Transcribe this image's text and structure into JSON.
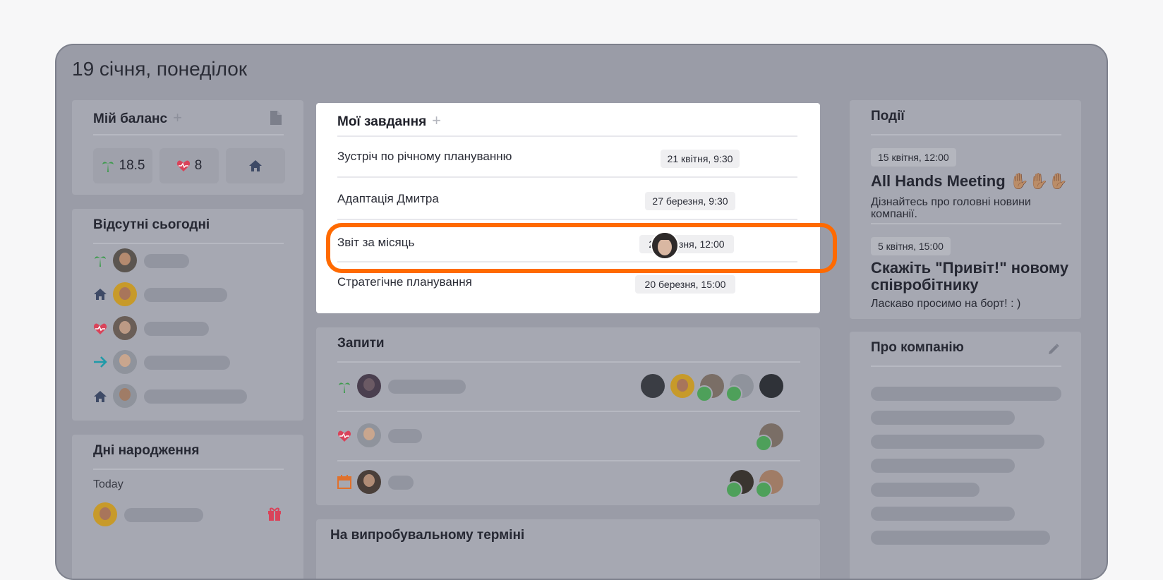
{
  "header": {
    "date": "19 січня, понеділок"
  },
  "balance": {
    "title": "Мій баланс",
    "vacation_days": "18.5",
    "sick_days": "8"
  },
  "absent": {
    "title": "Відсутні сьогодні"
  },
  "birthdays": {
    "title": "Дні народження",
    "today_label": "Today"
  },
  "tasks": {
    "title": "Мої завдання",
    "items": [
      {
        "name": "Зустріч по річному плануванню",
        "date": "21 квітня, 9:30"
      },
      {
        "name": "Адаптація Дмитра",
        "date": "27 березня, 9:30"
      },
      {
        "name": "Звіт за місяць",
        "date": "2 березня, 12:00"
      },
      {
        "name": "Стратегічне планування",
        "date": "20 березня, 15:00"
      }
    ]
  },
  "requests": {
    "title": "Запити"
  },
  "probation": {
    "title": "На випробувальному терміні"
  },
  "events": {
    "title": "Події",
    "items": [
      {
        "date": "15 квітня, 12:00",
        "title": "All Hands Meeting ✋🏽✋🏽✋🏽",
        "desc": "Дізнайтесь про головні новини компанії."
      },
      {
        "date": "5 квітня, 15:00",
        "title": "Скажіть \"Привіт!\" новому співробітнику",
        "desc": "Ласкаво просимо на борт! : )"
      }
    ]
  },
  "company": {
    "title": "Про компанію"
  },
  "colors": {
    "accent_highlight": "#ff6a00",
    "palm_green": "#3f9b4e",
    "heart_red": "#d9435a",
    "home_navy": "#3e4a66",
    "arrow_teal": "#1f9aa8",
    "calendar_orange": "#e0712c"
  },
  "icons": [
    "plus-icon",
    "document-icon",
    "palm-icon",
    "heart-icon",
    "home-icon",
    "arrow-right-icon",
    "calendar-icon",
    "gift-icon",
    "pencil-icon",
    "check-icon"
  ]
}
